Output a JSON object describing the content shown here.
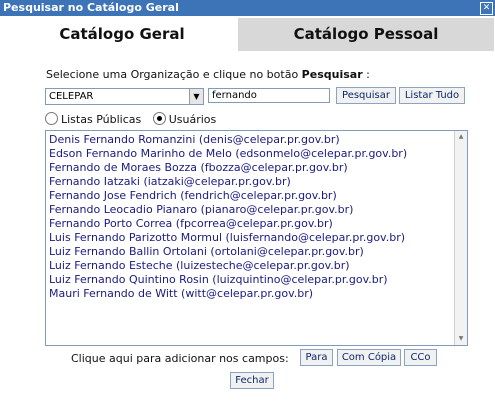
{
  "window": {
    "title": "Pesquisar no Catálogo Geral"
  },
  "tabs": [
    {
      "label": "Catálogo Geral",
      "active": true
    },
    {
      "label": "Catálogo Pessoal",
      "active": false
    }
  ],
  "form": {
    "instruction_prefix": "Selecione uma Organização e clique no botão ",
    "instruction_bold": "Pesquisar",
    "instruction_suffix": " :",
    "organization_value": "CELEPAR",
    "search_value": "fernando",
    "search_button": "Pesquisar",
    "list_all_button": "Listar Tudo"
  },
  "filter": {
    "public_lists_label": "Listas Públicas",
    "users_label": "Usuários",
    "selected": "Usuários"
  },
  "results": [
    "Denis Fernando Romanzini (denis@celepar.pr.gov.br)",
    "Edson Fernando Marinho de Melo (edsonmelo@celepar.pr.gov.br)",
    "Fernando de Moraes Bozza (fbozza@celepar.pr.gov.br)",
    "Fernando Iatzaki (iatzaki@celepar.pr.gov.br)",
    "Fernando Jose Fendrich (fendrich@celepar.pr.gov.br)",
    "Fernando Leocadio Pianaro (pianaro@celepar.pr.gov.br)",
    "Fernando Porto Correa (fpcorrea@celepar.pr.gov.br)",
    "Luis Fernando Parizotto Mormul (luisfernando@celepar.pr.gov.br)",
    "Luiz Fernando Ballin Ortolani (ortolani@celepar.pr.gov.br)",
    "Luiz Fernando Esteche (luizesteche@celepar.pr.gov.br)",
    "Luiz Fernando Quintino Rosin (luizquintino@celepar.pr.gov.br)",
    "Mauri Fernando de Witt (witt@celepar.pr.gov.br)"
  ],
  "footer": {
    "add_label": "Clique aqui para adicionar nos campos:",
    "to_button": "Para",
    "cc_button": "Com Cópia",
    "bcc_button": "CCo",
    "close_button": "Fechar"
  },
  "colors": {
    "titlebar": "#3d73b7",
    "inactive_tab": "#d8d8d8",
    "list_text": "#1a1a80"
  }
}
